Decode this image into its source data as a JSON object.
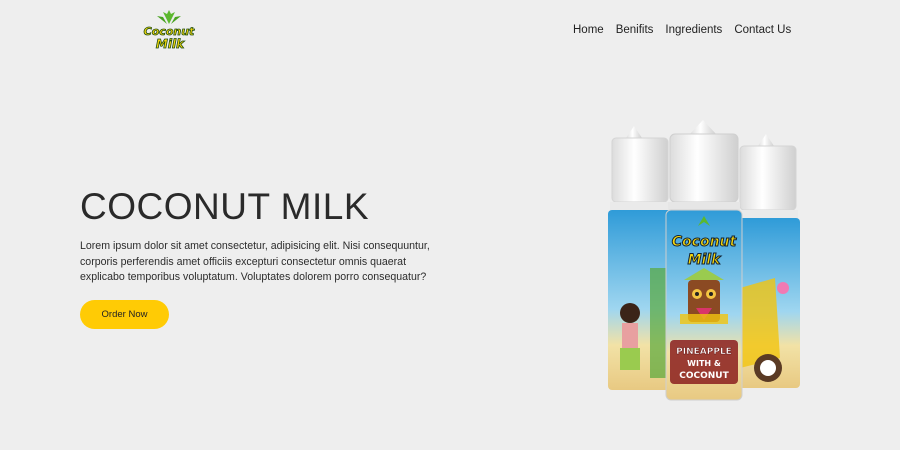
{
  "header": {
    "logo_text": [
      "Coconut",
      "Milk"
    ],
    "nav": [
      "Home",
      "Benifits",
      "Ingredients",
      "Contact Us"
    ]
  },
  "hero": {
    "title": "COCONUT MILK",
    "description": "Lorem ipsum dolor sit amet consectetur, adipisicing elit. Nisi consequuntur, corporis perferendis amet officiis excepturi consectetur omnis quaerat explicabo temporibus voluptatum. Voluptates dolorem porro consequatur?",
    "cta_label": "Order Now"
  },
  "product": {
    "label_brand": [
      "Coconut",
      "Milk"
    ],
    "flavor": [
      "PINEAPPLE",
      "WITH &",
      "COCONUT"
    ]
  },
  "colors": {
    "background": "#eeeeee",
    "accent": "#ffcb05",
    "logo_yellow": "#f5d60c",
    "logo_green": "#5cb82e",
    "label_sky": "#5fb8e3",
    "label_banner": "#8b1e1e"
  }
}
